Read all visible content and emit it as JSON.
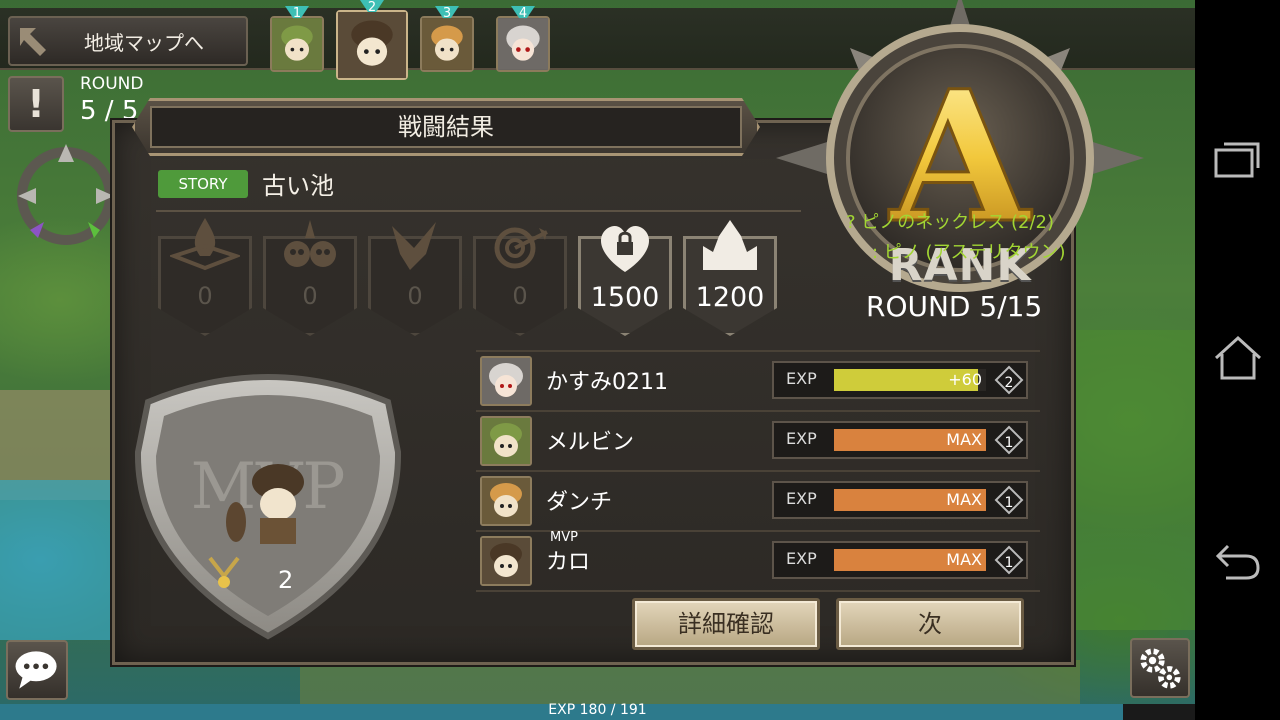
{
  "topbar": {
    "map_button": "地域マップへ",
    "party": [
      {
        "num": "1",
        "selected": false
      },
      {
        "num": "2",
        "selected": true
      },
      {
        "num": "3",
        "selected": false
      },
      {
        "num": "4",
        "selected": false
      }
    ]
  },
  "side": {
    "alert": "!",
    "round_label": "ROUND",
    "round_value": "5 / 5"
  },
  "panel": {
    "title": "戦闘結果",
    "tag": "STORY",
    "stage": "古い池",
    "bonuses": [
      {
        "icon": "flame-emblem-icon",
        "value": "0",
        "active": false
      },
      {
        "icon": "skulls-emblem-icon",
        "value": "0",
        "active": false
      },
      {
        "icon": "wing-emblem-icon",
        "value": "0",
        "active": false
      },
      {
        "icon": "target-arrow-icon",
        "value": "0",
        "active": false
      },
      {
        "icon": "locked-heart-icon",
        "value": "1500",
        "active": true
      },
      {
        "icon": "crown-castle-icon",
        "value": "1200",
        "active": true
      }
    ],
    "mvp_watermark": "MVP",
    "mvp_count": "2",
    "characters": [
      {
        "name": "かすみ0211",
        "mvp": "",
        "exp_label": "EXP",
        "exp_text": "+60",
        "exp_fill": 0.95,
        "fill_color": "#cfcc3a",
        "level": "2"
      },
      {
        "name": "メルビン",
        "mvp": "",
        "exp_label": "EXP",
        "exp_text": "MAX",
        "exp_fill": 1.0,
        "fill_color": "#d9823e",
        "level": "1"
      },
      {
        "name": "ダンチ",
        "mvp": "",
        "exp_label": "EXP",
        "exp_text": "MAX",
        "exp_fill": 1.0,
        "fill_color": "#d9823e",
        "level": "1"
      },
      {
        "name": "カロ",
        "mvp": "MVP",
        "exp_label": "EXP",
        "exp_text": "MAX",
        "exp_fill": 1.0,
        "fill_color": "#d9823e",
        "level": "1"
      }
    ],
    "buttons": {
      "details": "詳細確認",
      "next": "次"
    }
  },
  "rank": {
    "letter": "A",
    "word": "RANK",
    "round": "ROUND 5/15",
    "quest_line1": "? ピノのネックレス (2/2)",
    "quest_line2": ": ピノ (アステリタウン)"
  },
  "footer": {
    "exp_text": "EXP 180 / 191",
    "exp_fill": 0.94
  },
  "colors": {
    "accent": "#a2d633",
    "story": "#4f9a3b",
    "gold": "#e8c24a"
  }
}
